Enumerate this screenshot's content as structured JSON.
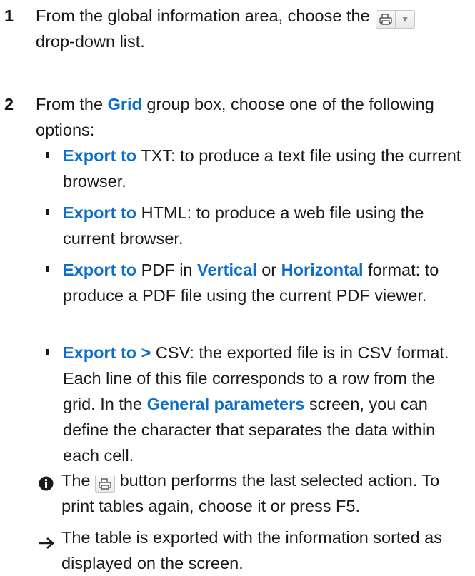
{
  "step1": {
    "number": "1",
    "text_before": "From the global information area, choose the",
    "text_after": "drop-down list.",
    "print_icon": "print-icon",
    "dropdown_icon": "triangle-down-icon",
    "dropdown_arrow": "▼"
  },
  "step2": {
    "number": "2",
    "text_before": "From the",
    "grid_label": "Grid",
    "text_after": "group box, choose one of the following options:",
    "bullets": [
      {
        "export_label": "Export to",
        "rest": "TXT: to produce a text file using the current browser."
      },
      {
        "export_label": "Export to",
        "rest": "HTML: to produce a web file using the current browser."
      },
      {
        "export_label": "Export to",
        "mid1": "PDF in",
        "vertical_label": "Vertical",
        "mid2": "or",
        "horizontal_label": "Horizontal",
        "rest": "format: to produce a PDF file using the current PDF viewer."
      },
      {
        "export_label": "Export to >",
        "rest_before": "CSV: the exported file is in CSV format. Each line of this file corresponds to a row from the grid. In the",
        "general_label": "General parameters",
        "rest_after": "screen, you can define the character that separates the data within each cell."
      }
    ]
  },
  "note": {
    "icon": "info-icon",
    "text_before": "The",
    "text_after": "button performs the last selected action. To print tables again, choose it or press F5."
  },
  "result": {
    "icon": "arrow-right-icon",
    "text": "The table is exported with the information sorted as displayed on the screen."
  },
  "colors": {
    "accent": "#0c6ec6",
    "text": "#1a1a1a"
  }
}
